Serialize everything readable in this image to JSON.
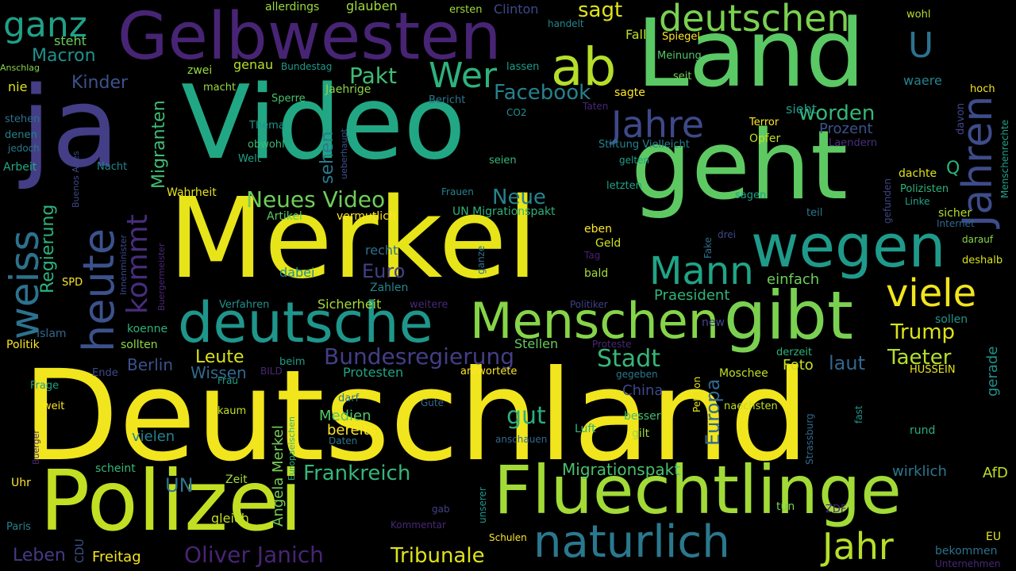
{
  "words": [
    {
      "text": "Deutschland",
      "color": "#f1e51d"
    },
    {
      "text": "Merkel",
      "color": "#e7e419"
    },
    {
      "text": "Video",
      "color": "#22a784"
    },
    {
      "text": "Land",
      "color": "#5ac864"
    },
    {
      "text": "geht",
      "color": "#5ec962"
    },
    {
      "text": "ja",
      "color": "#433e85"
    },
    {
      "text": "Polizei",
      "color": "#c2df23"
    },
    {
      "text": "Fluechtlinge",
      "color": "#a2da37"
    },
    {
      "text": "Gelbwesten",
      "color": "#482475"
    },
    {
      "text": "gibt",
      "color": "#7ad151"
    },
    {
      "text": "wegen",
      "color": "#1f9a8a"
    },
    {
      "text": "deutsche",
      "color": "#1f968b"
    },
    {
      "text": "Menschen",
      "color": "#86d549"
    },
    {
      "text": "naturlich",
      "color": "#2a788e"
    },
    {
      "text": "heute",
      "color": "#3b528b"
    },
    {
      "text": "Jahren",
      "color": "#3e4c8a"
    },
    {
      "text": "deutschen",
      "color": "#7ad151"
    },
    {
      "text": "ab",
      "color": "#b5de2b"
    },
    {
      "text": "weiss",
      "color": "#2c728e"
    },
    {
      "text": "Jahr",
      "color": "#b5de2b"
    },
    {
      "text": "viele",
      "color": "#f1e51d"
    },
    {
      "text": "Jahre",
      "color": "#3e4989"
    },
    {
      "text": "Mann",
      "color": "#20a486"
    },
    {
      "text": "ganz",
      "color": "#1fa188"
    },
    {
      "text": "Wer",
      "color": "#2db27d"
    },
    {
      "text": "kommt",
      "color": "#472d7b"
    },
    {
      "text": "U",
      "color": "#2c728e"
    },
    {
      "text": "sagt",
      "color": "#dfe318"
    },
    {
      "text": "Leben",
      "color": "#443a83"
    },
    {
      "text": "Oliver Janich",
      "color": "#482475"
    },
    {
      "text": "Tribunale",
      "color": "#dde318"
    },
    {
      "text": "Bundesregierung",
      "color": "#433e85"
    },
    {
      "text": "Stadt",
      "color": "#35b779"
    },
    {
      "text": "Taeter",
      "color": "#b5de2b"
    },
    {
      "text": "Trump",
      "color": "#dde318"
    },
    {
      "text": "Pakt",
      "color": "#3fbc73"
    },
    {
      "text": "Facebook",
      "color": "#26828e"
    },
    {
      "text": "Neues Video",
      "color": "#6ece58"
    },
    {
      "text": "Frankreich",
      "color": "#35b779"
    },
    {
      "text": "gut",
      "color": "#29af7f"
    },
    {
      "text": "Migrationspakt",
      "color": "#48c16e"
    },
    {
      "text": "Europa",
      "color": "#31688e"
    },
    {
      "text": "laut",
      "color": "#31688e"
    },
    {
      "text": "worden",
      "color": "#35b779"
    },
    {
      "text": "Migranten",
      "color": "#3fbc73"
    },
    {
      "text": "Regierung",
      "color": "#2db27d"
    },
    {
      "text": "Macron",
      "color": "#21918c"
    },
    {
      "text": "Neue",
      "color": "#25838e"
    },
    {
      "text": "Euro",
      "color": "#424086"
    },
    {
      "text": "Leute",
      "color": "#d8e219"
    },
    {
      "text": "Berlin",
      "color": "#3b528b"
    },
    {
      "text": "Wissen",
      "color": "#31688e"
    },
    {
      "text": "Kinder",
      "color": "#3b528b"
    },
    {
      "text": "sehen",
      "color": "#287c8e"
    },
    {
      "text": "Angela Merkel",
      "color": "#75d054"
    },
    {
      "text": "Foto",
      "color": "#c8e020"
    },
    {
      "text": "gerade",
      "color": "#21918c"
    },
    {
      "text": "Praesident",
      "color": "#2fb47c"
    },
    {
      "text": "einfach",
      "color": "#6ece58"
    },
    {
      "text": "UN",
      "color": "#2c728e"
    },
    {
      "text": "Stellen",
      "color": "#65cb5e"
    },
    {
      "text": "Medien",
      "color": "#52c569"
    },
    {
      "text": "bereits",
      "color": "#fde725"
    },
    {
      "text": "vielen",
      "color": "#26828e"
    },
    {
      "text": "China",
      "color": "#3e4989"
    },
    {
      "text": "Prozent",
      "color": "#3b528b"
    },
    {
      "text": "Sicherheit",
      "color": "#a8db34"
    },
    {
      "text": "Protesten",
      "color": "#20a386"
    },
    {
      "text": "AfD",
      "color": "#c2df23"
    },
    {
      "text": "wirklich",
      "color": "#2a788e"
    },
    {
      "text": "Freitag",
      "color": "#f4e61e"
    },
    {
      "text": "Artikel",
      "color": "#5cc863"
    },
    {
      "text": "vermutlich",
      "color": "#fde725"
    },
    {
      "text": "UN Migrationspakt",
      "color": "#2db27d"
    },
    {
      "text": "Wahrheit",
      "color": "#e5e419"
    },
    {
      "text": "dabei",
      "color": "#21918c"
    },
    {
      "text": "recht",
      "color": "#2c728e"
    },
    {
      "text": "Zahlen",
      "color": "#24878e"
    },
    {
      "text": "Geld",
      "color": "#d0e11c"
    },
    {
      "text": "eben",
      "color": "#fde725"
    },
    {
      "text": "bald",
      "color": "#a5db36"
    },
    {
      "text": "genau",
      "color": "#b8de29"
    },
    {
      "text": "zwei",
      "color": "#99d83d"
    },
    {
      "text": "macht",
      "color": "#9bd93c"
    },
    {
      "text": "Jaehrige",
      "color": "#8bd646"
    },
    {
      "text": "Sperre",
      "color": "#4ac16d"
    },
    {
      "text": "Thema",
      "color": "#1f968b"
    },
    {
      "text": "obwohl",
      "color": "#3aba76"
    },
    {
      "text": "Welt",
      "color": "#20a386"
    },
    {
      "text": "steht",
      "color": "#6ccd5a"
    },
    {
      "text": "nie",
      "color": "#dde318"
    },
    {
      "text": "stehen",
      "color": "#2d708e"
    },
    {
      "text": "denen",
      "color": "#26828e"
    },
    {
      "text": "jedoch",
      "color": "#2a788e"
    },
    {
      "text": "Arbeit",
      "color": "#22a884"
    },
    {
      "text": "Nacht",
      "color": "#25858e"
    },
    {
      "text": "Anschlag",
      "color": "#86d549"
    },
    {
      "text": "allerdings",
      "color": "#9bd93c"
    },
    {
      "text": "glauben",
      "color": "#9fda3a"
    },
    {
      "text": "ersten",
      "color": "#a0da39"
    },
    {
      "text": "Clinton",
      "color": "#3e4989"
    },
    {
      "text": "handelt",
      "color": "#24878e"
    },
    {
      "text": "Bundestag",
      "color": "#1f9a8a"
    },
    {
      "text": "lassen",
      "color": "#1f9e89"
    },
    {
      "text": "Bericht",
      "color": "#2a788e"
    },
    {
      "text": "CO2",
      "color": "#21918c"
    },
    {
      "text": "Taten",
      "color": "#482878"
    },
    {
      "text": "Fall",
      "color": "#c2df23"
    },
    {
      "text": "Spiegel",
      "color": "#fde725"
    },
    {
      "text": "Meinung",
      "color": "#52c569"
    },
    {
      "text": "seit",
      "color": "#75d054"
    },
    {
      "text": "sagte",
      "color": "#fde725"
    },
    {
      "text": "wohl",
      "color": "#b5de2b"
    },
    {
      "text": "waere",
      "color": "#25838e"
    },
    {
      "text": "hoch",
      "color": "#f8e621"
    },
    {
      "text": "davon",
      "color": "#404688"
    },
    {
      "text": "Menschenrechte",
      "color": "#1fa188"
    },
    {
      "text": "sieht",
      "color": "#1f9a8a"
    },
    {
      "text": "Terror",
      "color": "#fde725"
    },
    {
      "text": "Opfer",
      "color": "#c2df23"
    },
    {
      "text": "Laendern",
      "color": "#472f7d"
    },
    {
      "text": "Stiftung Vielleicht",
      "color": "#26828e"
    },
    {
      "text": "gelten",
      "color": "#1fa088"
    },
    {
      "text": "seien",
      "color": "#37b878"
    },
    {
      "text": "dachte",
      "color": "#dde318"
    },
    {
      "text": "Q",
      "color": "#2db27d"
    },
    {
      "text": "Polizisten",
      "color": "#2db27d"
    },
    {
      "text": "Linke",
      "color": "#20a386"
    },
    {
      "text": "gefunden",
      "color": "#414487"
    },
    {
      "text": "letzten",
      "color": "#20a386"
    },
    {
      "text": "sagen",
      "color": "#1fa188"
    },
    {
      "text": "teil",
      "color": "#2a788e"
    },
    {
      "text": "sicher",
      "color": "#b2dd2d"
    },
    {
      "text": "Internet",
      "color": "#31688e"
    },
    {
      "text": "darauf",
      "color": "#8bd646"
    },
    {
      "text": "deshalb",
      "color": "#d8e219"
    },
    {
      "text": "drei",
      "color": "#3e4989"
    },
    {
      "text": "Fake",
      "color": "#2c728e"
    },
    {
      "text": "Tag",
      "color": "#482173"
    },
    {
      "text": "ganze",
      "color": "#2c728e"
    },
    {
      "text": "Frauen",
      "color": "#25838e"
    },
    {
      "text": "ueberhaupt",
      "color": "#3b528b"
    },
    {
      "text": "Buenos Aires",
      "color": "#3e4989"
    },
    {
      "text": "Innenminister",
      "color": "#3e4989"
    },
    {
      "text": "Buergermeister",
      "color": "#482878"
    },
    {
      "text": "SPD",
      "color": "#fde725"
    },
    {
      "text": "Islam",
      "color": "#31688e"
    },
    {
      "text": "koenne",
      "color": "#2db27d"
    },
    {
      "text": "sollten",
      "color": "#8bd646"
    },
    {
      "text": "Politik",
      "color": "#fde725"
    },
    {
      "text": "Verfahren",
      "color": "#21918c"
    },
    {
      "text": "weitere",
      "color": "#482878"
    },
    {
      "text": "Politiker",
      "color": "#424086"
    },
    {
      "text": "new",
      "color": "#404688"
    },
    {
      "text": "sollen",
      "color": "#1f968b"
    },
    {
      "text": "Proteste",
      "color": "#482878"
    },
    {
      "text": "derzeit",
      "color": "#2db27d"
    },
    {
      "text": "Moschee",
      "color": "#c2df23"
    },
    {
      "text": "HUSSEIN",
      "color": "#e7e419"
    },
    {
      "text": "Petition",
      "color": "#e5e419"
    },
    {
      "text": "gegeben",
      "color": "#2a788e"
    },
    {
      "text": "antwortete",
      "color": "#fde725"
    },
    {
      "text": "Ende",
      "color": "#3e4989"
    },
    {
      "text": "BILD",
      "color": "#482878"
    },
    {
      "text": "beim",
      "color": "#1f9e89"
    },
    {
      "text": "Frau",
      "color": "#1fa088"
    },
    {
      "text": "Frage",
      "color": "#1f9e89"
    },
    {
      "text": "weit",
      "color": "#fde725"
    },
    {
      "text": "darf",
      "color": "#2a788e"
    },
    {
      "text": "Gute",
      "color": "#31688e"
    },
    {
      "text": "kaum",
      "color": "#c2df23"
    },
    {
      "text": "Europaeischen",
      "color": "#2db27d"
    },
    {
      "text": "Buerger",
      "color": "#482878"
    },
    {
      "text": "Daten",
      "color": "#2c728e"
    },
    {
      "text": "Luft",
      "color": "#2db27d"
    },
    {
      "text": "besser",
      "color": "#3fbc73"
    },
    {
      "text": "gilt",
      "color": "#a0da39"
    },
    {
      "text": "naechsten",
      "color": "#c2df23"
    },
    {
      "text": "anschauen",
      "color": "#31688e"
    },
    {
      "text": "Strassburg",
      "color": "#31688e"
    },
    {
      "text": "fast",
      "color": "#1f968b"
    },
    {
      "text": "rund",
      "color": "#29af7f"
    },
    {
      "text": "scheint",
      "color": "#35b779"
    },
    {
      "text": "Zeit",
      "color": "#a5db36"
    },
    {
      "text": "Uhr",
      "color": "#fde725"
    },
    {
      "text": "Paris",
      "color": "#26828e"
    },
    {
      "text": "gleich",
      "color": "#c2df23"
    },
    {
      "text": "CDU",
      "color": "#3b528b"
    },
    {
      "text": "unserer",
      "color": "#1f968b"
    },
    {
      "text": "gab",
      "color": "#424086"
    },
    {
      "text": "Kommentar",
      "color": "#482878"
    },
    {
      "text": "tun",
      "color": "#75d054"
    },
    {
      "text": "ZDF",
      "color": "#482475"
    },
    {
      "text": "Schulen",
      "color": "#fde725"
    },
    {
      "text": "EU",
      "color": "#e7e419"
    },
    {
      "text": "bekommen",
      "color": "#2c728e"
    },
    {
      "text": "Unternehmen",
      "color": "#482878"
    }
  ]
}
